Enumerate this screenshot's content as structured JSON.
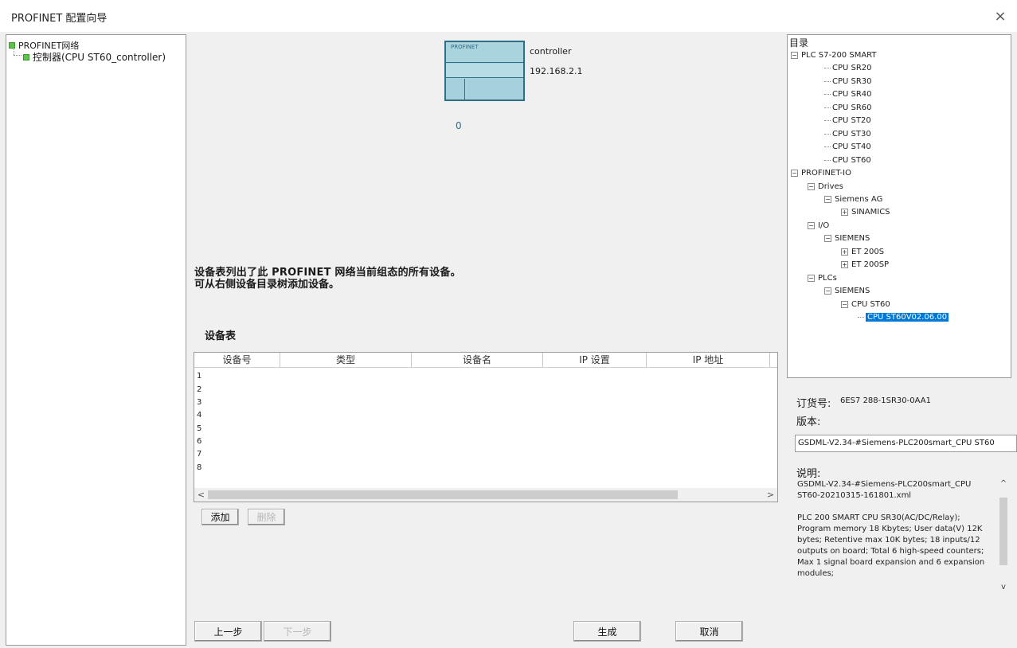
{
  "window": {
    "title": "PROFINET 配置向导",
    "close_glyph": "×"
  },
  "left_tree": {
    "root": "PROFINET网络",
    "child": "控制器(CPU ST60_controller)"
  },
  "controller": {
    "tag": "PROFINET",
    "port": "0",
    "name": "controller",
    "ip": "192.168.2.1"
  },
  "info": {
    "line1": "设备表列出了此 PROFINET 网络当前组态的所有设备。",
    "line2": "可从右侧设备目录树添加设备。"
  },
  "device_table": {
    "title": "设备表",
    "columns": [
      "设备号",
      "类型",
      "设备名",
      "IP 设置",
      "IP 地址"
    ],
    "rows": [
      "1",
      "2",
      "3",
      "4",
      "5",
      "6",
      "7",
      "8"
    ],
    "scroll_left": "<",
    "scroll_right": ">"
  },
  "buttons": {
    "add": "添加",
    "delete": "删除",
    "prev": "上一步",
    "next": "下一步",
    "generate": "生成",
    "cancel": "取消"
  },
  "catalog": {
    "title": "目录",
    "nodes": [
      {
        "label": "PLC S7-200 SMART",
        "exp": "−"
      },
      {
        "label": "CPU SR20"
      },
      {
        "label": "CPU SR30"
      },
      {
        "label": "CPU SR40"
      },
      {
        "label": "CPU SR60"
      },
      {
        "label": "CPU ST20"
      },
      {
        "label": "CPU ST30"
      },
      {
        "label": "CPU ST40"
      },
      {
        "label": "CPU ST60"
      },
      {
        "label": "PROFINET-IO",
        "exp": "−"
      },
      {
        "label": "Drives",
        "exp": "−"
      },
      {
        "label": "Siemens AG",
        "exp": "−"
      },
      {
        "label": "SINAMICS",
        "exp": "+"
      },
      {
        "label": "I/O",
        "exp": "−"
      },
      {
        "label": "SIEMENS",
        "exp": "−"
      },
      {
        "label": "ET 200S",
        "exp": "+"
      },
      {
        "label": "ET 200SP",
        "exp": "+"
      },
      {
        "label": "PLCs",
        "exp": "−"
      },
      {
        "label": "SIEMENS",
        "exp": "−"
      },
      {
        "label": "CPU ST60",
        "exp": "−"
      },
      {
        "label": "CPU ST60V02.06.00",
        "selected": true
      }
    ]
  },
  "details": {
    "order_label": "订货号:",
    "order_value": "6ES7 288-1SR30-0AA1",
    "version_label": "版本:",
    "version_value": "GSDML-V2.34-#Siemens-PLC200smart_CPU ST60",
    "desc_label": "说明:",
    "desc_text": "GSDML-V2.34-#Siemens-PLC200smart_CPU ST60-20210315-161801.xml\n\nPLC 200 SMART CPU SR30(AC/DC/Relay); Program memory 18 Kbytes; User data(V) 12K bytes; Retentive max 10K bytes; 18 inputs/12 outputs on board; Total 6 high-speed counters; Max 1 signal board expansion and 6 expansion modules;",
    "scroll_up": "^",
    "scroll_down": "v"
  }
}
